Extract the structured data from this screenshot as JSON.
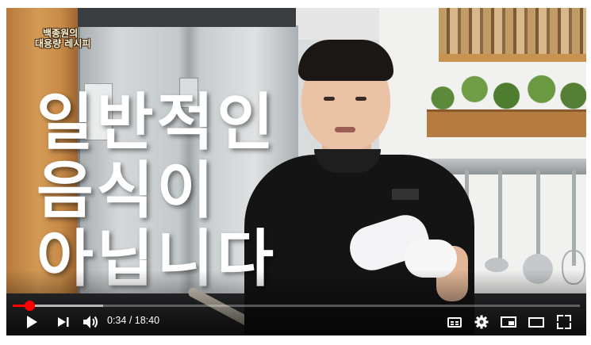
{
  "channel_logo": {
    "line1": "백종원의",
    "line2": "대용량 레시피"
  },
  "caption": {
    "lines": [
      "일반적인",
      "음식이",
      "아닙니다"
    ]
  },
  "player": {
    "current_time": "0:34",
    "separator": " / ",
    "duration": "18:40",
    "progress_played_fraction": 0.03,
    "progress_buffered_fraction": 0.16,
    "colors": {
      "progress": "#ff0000",
      "icons": "#ffffff"
    },
    "icons": [
      "play-icon",
      "next-icon",
      "volume-icon",
      "subtitles-icon",
      "settings-gear-icon",
      "miniplayer-icon",
      "theater-mode-icon",
      "fullscreen-icon"
    ]
  }
}
